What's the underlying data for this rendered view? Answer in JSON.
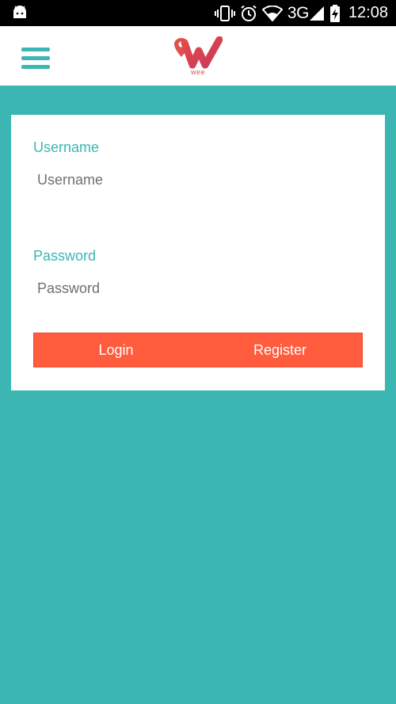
{
  "status_bar": {
    "network": "3G",
    "time": "12:08",
    "icons": [
      "android-icon",
      "vibrate-icon",
      "alarm-icon",
      "wifi-icon",
      "signal-icon",
      "battery-charging-icon"
    ]
  },
  "header": {
    "menu_icon": "hamburger-menu-icon",
    "logo_text": "wee"
  },
  "login_form": {
    "username_label": "Username",
    "username_placeholder": "Username",
    "username_value": "",
    "password_label": "Password",
    "password_placeholder": "Password",
    "password_value": "",
    "login_label": "Login",
    "register_label": "Register"
  },
  "colors": {
    "accent": "#3cb6b3",
    "button": "#ff5b3d",
    "logo": "#e0504f"
  }
}
